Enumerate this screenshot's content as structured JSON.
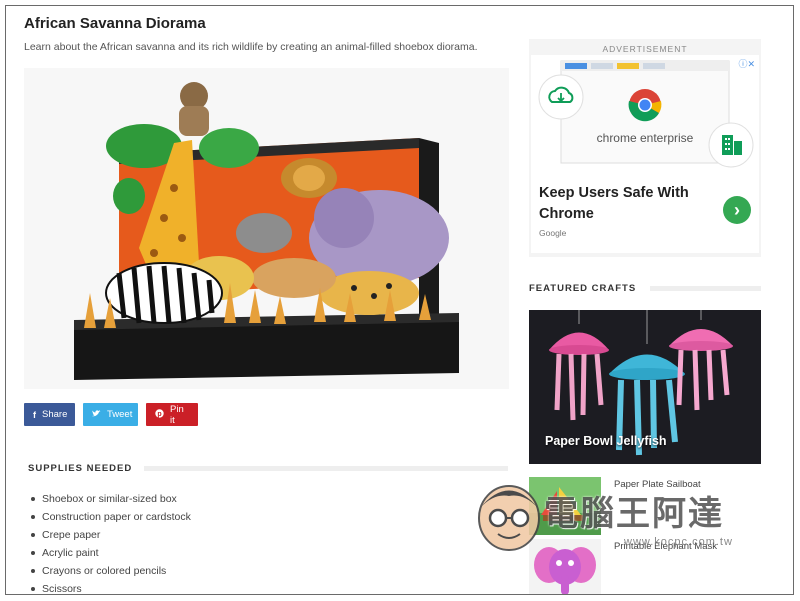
{
  "article": {
    "title": "African Savanna Diorama",
    "description": "Learn about the African savanna and its rich wildlife by creating an animal-filled shoebox diorama."
  },
  "share": {
    "facebook_label": "Share",
    "twitter_label": "Tweet",
    "pinterest_label": "Pin it",
    "colors": {
      "facebook": "#3b5998",
      "twitter": "#3aaee6",
      "pinterest": "#cb2027"
    }
  },
  "supplies": {
    "heading": "SUPPLIES NEEDED",
    "items": [
      "Shoebox or similar-sized box",
      "Construction paper or cardstock",
      "Crepe paper",
      "Acrylic paint",
      "Crayons or colored pencils",
      "Scissors"
    ]
  },
  "ad": {
    "label": "ADVERTISEMENT",
    "brand_text": "chrome enterprise",
    "headline": "Keep Users Safe With Chrome",
    "source": "Google",
    "info_icon": "info-icon",
    "cta_icon": "chevron-right-icon",
    "accent": "#34a853"
  },
  "featured": {
    "heading": "FEATURED CRAFTS",
    "main_title": "Paper Bowl Jellyfish",
    "items": [
      {
        "label": "Paper Plate Sailboat"
      },
      {
        "label": "Printable Elephant Mask"
      }
    ]
  },
  "watermark": {
    "text": "電腦王阿達",
    "url": "www.kocpc.com.tw"
  }
}
